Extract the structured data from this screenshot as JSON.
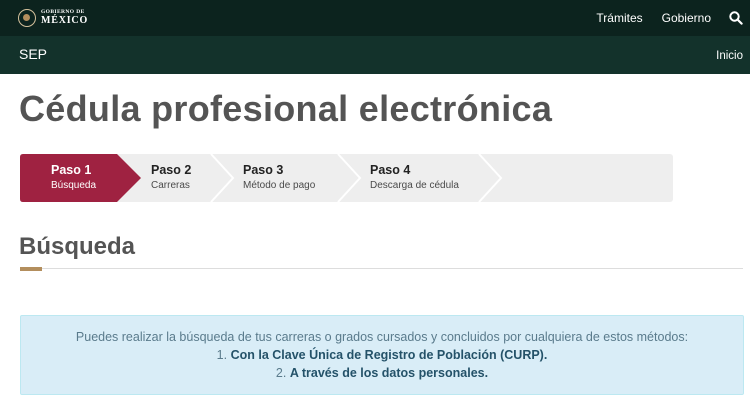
{
  "gov_header": {
    "logo_line1": "GOBIERNO DE",
    "logo_line2": "MÉXICO",
    "nav": [
      "Trámites",
      "Gobierno"
    ],
    "search_icon": "search-icon"
  },
  "sep_bar": {
    "label": "SEP",
    "inicio": "Inicio"
  },
  "page": {
    "title": "Cédula profesional electrónica"
  },
  "stepper": {
    "active_color": "#9f2241",
    "steps": [
      {
        "title": "Paso 1",
        "subtitle": "Búsqueda",
        "active": true
      },
      {
        "title": "Paso 2",
        "subtitle": "Carreras",
        "active": false
      },
      {
        "title": "Paso 3",
        "subtitle": "Método de pago",
        "active": false
      },
      {
        "title": "Paso 4",
        "subtitle": "Descarga de cédula",
        "active": false
      }
    ]
  },
  "section": {
    "title": "Búsqueda",
    "accent_color": "#b38e5d"
  },
  "info": {
    "intro": "Puedes realizar la búsqueda de tus carreras o grados cursados y concluidos por cualquiera de estos métodos:",
    "methods": [
      {
        "number": "1.",
        "label": "Con la Clave Única de Registro de Población (CURP)."
      },
      {
        "number": "2.",
        "label": "A través de los datos personales."
      }
    ]
  }
}
